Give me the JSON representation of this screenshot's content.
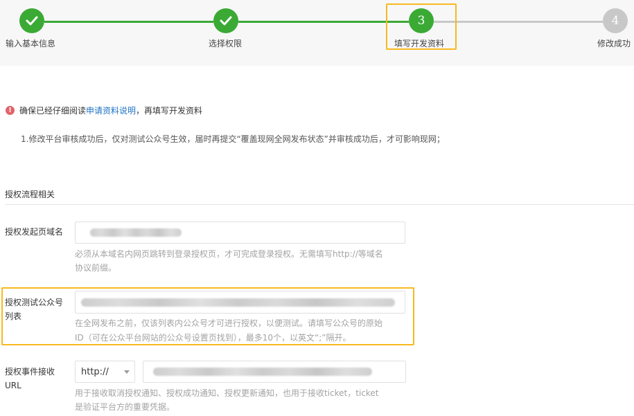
{
  "steps": [
    {
      "label": "输入基本信息",
      "status": "done"
    },
    {
      "label": "选择权限",
      "status": "done"
    },
    {
      "number": "3",
      "label": "填写开发资料",
      "status": "current"
    },
    {
      "number": "4",
      "label": "修改成功",
      "status": "pending"
    }
  ],
  "colors": {
    "done": "#3aaa35",
    "pending": "#c8c8c8",
    "highlight": "#f7b91f",
    "link": "#1e73c6",
    "warning": "#e0646b"
  },
  "icons": {
    "check": "check-icon",
    "warning": "warning-icon",
    "dropdown": "chevron-down-icon"
  },
  "notice": {
    "icon_glyph": "!",
    "before": "确保已经仔细阅读",
    "link": "申请资料说明",
    "after": "，再填写开发资料"
  },
  "note": "1.修改平台审核成功后，仅对测试公众号生效，届时再提交“覆盖现网全网发布状态”并审核成功后，才可影响现网；",
  "section_title": "授权流程相关",
  "fields": {
    "domain": {
      "label": "授权发起页域名",
      "hint_line1": "必须从本域名内网页跳转到登录授权页，才可完成登录授权。无需填写http://等域名",
      "hint_line2": "协议前缀。"
    },
    "test_accounts": {
      "label_line1": "授权测试公众号",
      "label_line2": "列表",
      "hint_line1": "在全网发布之前，仅该列表内公众号才可进行授权，以便测试。请填写公众号的原始",
      "hint_line2": "ID（可在公众平台网站的公众号设置页找到），最多10个，以英文“;”隔开。"
    },
    "event_url": {
      "label_line1": "授权事件接收",
      "label_line2": "URL",
      "protocol_selected": "http://",
      "hint_line1": "用于接收取消授权通知、授权成功通知、授权更新通知，也用于接收ticket，ticket",
      "hint_line2": "是验证平台方的重要凭据。"
    }
  }
}
